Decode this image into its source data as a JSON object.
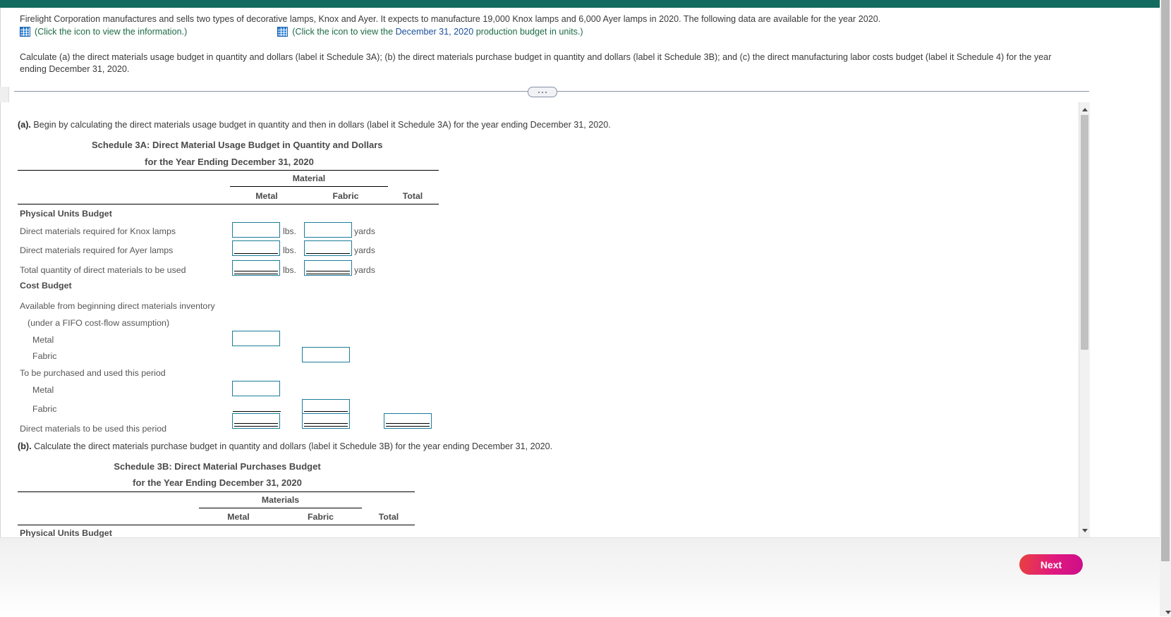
{
  "top_bar_color": "#126b5e",
  "question": {
    "statement": "Firelight Corporation manufactures and sells two types of decorative lamps, Knox and Ayer. It expects to manufacture 19,000 Knox lamps and 6,000 Ayer lamps in 2020. The following data are available for the year 2020.",
    "icon_link_1": "(Click the icon to view the information.)",
    "icon_link_2_pre": "(Click the icon to view the ",
    "icon_link_2_date": "December 31, 2020",
    "icon_link_2_post": " production budget in units.)",
    "instruction": "Calculate (a) the direct materials usage budget in quantity and dollars (label it Schedule 3A); (b) the direct materials purchase budget in quantity and dollars (label it Schedule 3B); and (c) the direct manufacturing labor costs budget (label it Schedule 4) for the year ending December 31, 2020."
  },
  "part_a": {
    "prompt_label": "(a).",
    "prompt_text": "Begin by calculating the direct materials usage budget in quantity and then in dollars (label it Schedule 3A) for the year ending December 31, 2020.",
    "schedule_title": "Schedule 3A: Direct Material Usage Budget in Quantity and Dollars",
    "schedule_subtitle": "for the Year Ending December 31, 2020",
    "group_header": "Material",
    "columns": [
      "Metal",
      "Fabric",
      "Total"
    ],
    "section_1_header": "Physical Units Budget",
    "rows_physical": [
      {
        "label": "Direct materials required for Knox lamps",
        "unit_metal": "lbs.",
        "unit_fabric": "yards",
        "value_metal": "",
        "value_fabric": "",
        "rule": "none"
      },
      {
        "label": "Direct materials required for Ayer lamps",
        "unit_metal": "lbs.",
        "unit_fabric": "yards",
        "value_metal": "",
        "value_fabric": "",
        "rule": "single"
      },
      {
        "label": "Total quantity of direct materials to be used",
        "unit_metal": "lbs.",
        "unit_fabric": "yards",
        "value_metal": "",
        "value_fabric": "",
        "rule": "double"
      }
    ],
    "section_2_header": "Cost Budget",
    "rows_cost": [
      {
        "label": "Available from beginning direct materials inventory",
        "type": "text"
      },
      {
        "label": "(under a FIFO cost-flow assumption)",
        "type": "text-indent"
      },
      {
        "label": "Metal",
        "type": "input-metal",
        "value": "",
        "rule": "none"
      },
      {
        "label": "Fabric",
        "type": "input-fabric",
        "value": "",
        "rule": "none"
      },
      {
        "label": "To be purchased and used this period",
        "type": "text"
      },
      {
        "label": "Metal",
        "type": "input-metal",
        "value": "",
        "rule": "none"
      },
      {
        "label": "Fabric",
        "type": "input-fabric",
        "value": "",
        "rule": "single"
      },
      {
        "label": "Direct materials to be used this period",
        "type": "input-all",
        "value_metal": "",
        "value_fabric": "",
        "value_total": "",
        "rule": "double"
      }
    ]
  },
  "part_b": {
    "prompt_label": "(b).",
    "prompt_text": "Calculate the direct materials purchase budget in quantity and dollars (label it Schedule 3B) for the year ending December 31, 2020.",
    "schedule_title": "Schedule 3B: Direct Material Purchases Budget",
    "schedule_subtitle": "for the Year Ending December 31, 2020",
    "group_header": "Materials",
    "columns": [
      "Metal",
      "Fabric",
      "Total"
    ],
    "section_header_partial": "Physical Units Budget"
  },
  "footer": {
    "next_label": "Next"
  }
}
